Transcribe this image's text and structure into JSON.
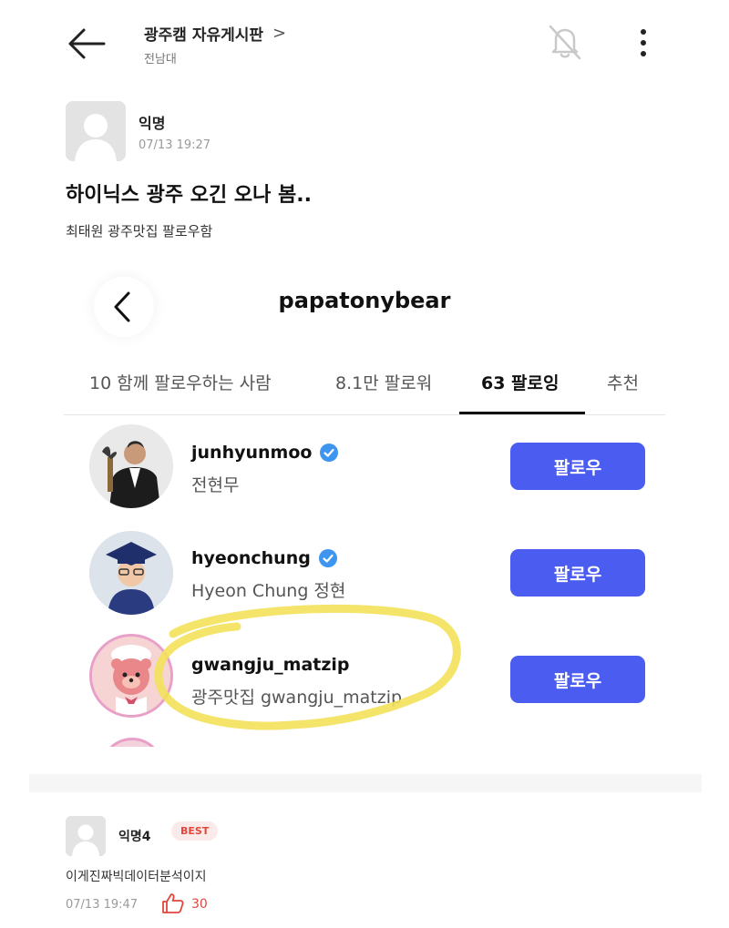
{
  "header": {
    "board_title": "광주캠 자유게시판",
    "board_chevron": ">",
    "board_subtitle": "전남대"
  },
  "post": {
    "author": "익명",
    "date": "07/13 19:27",
    "title": "하이닉스 광주 오긴 오나 봄..",
    "body": "최태원 광주맛집 팔로우함"
  },
  "embed": {
    "username": "papatonybear",
    "tabs": [
      {
        "label": "10 함께 팔로우하는 사람",
        "active": false
      },
      {
        "label": "8.1만 팔로워",
        "active": false
      },
      {
        "label": "63 팔로잉",
        "active": true
      },
      {
        "label": "추천",
        "active": false
      }
    ],
    "accounts": [
      {
        "handle": "junhyunmoo",
        "name": "전현무",
        "verified": true,
        "button": "팔로우"
      },
      {
        "handle": "hyeonchung",
        "name": "Hyeon Chung 정현",
        "verified": true,
        "button": "팔로우"
      },
      {
        "handle": "gwangju_matzip",
        "name": "광주맛집 gwangju_matzip",
        "verified": false,
        "button": "팔로우",
        "highlighted": true
      }
    ],
    "highlight_color": "#f3e15a",
    "button_color": "#4b5cf0"
  },
  "comment": {
    "author": "익명4",
    "badge": "BEST",
    "text": "이게진짜빅데이터분석이지",
    "date": "07/13 19:47",
    "likes": "30"
  },
  "icons": {
    "back": "arrow-left-icon",
    "notifications": "bell-off-icon",
    "more": "more-vertical-icon",
    "like": "thumbs-up-icon",
    "verified": "verified-badge-icon"
  }
}
